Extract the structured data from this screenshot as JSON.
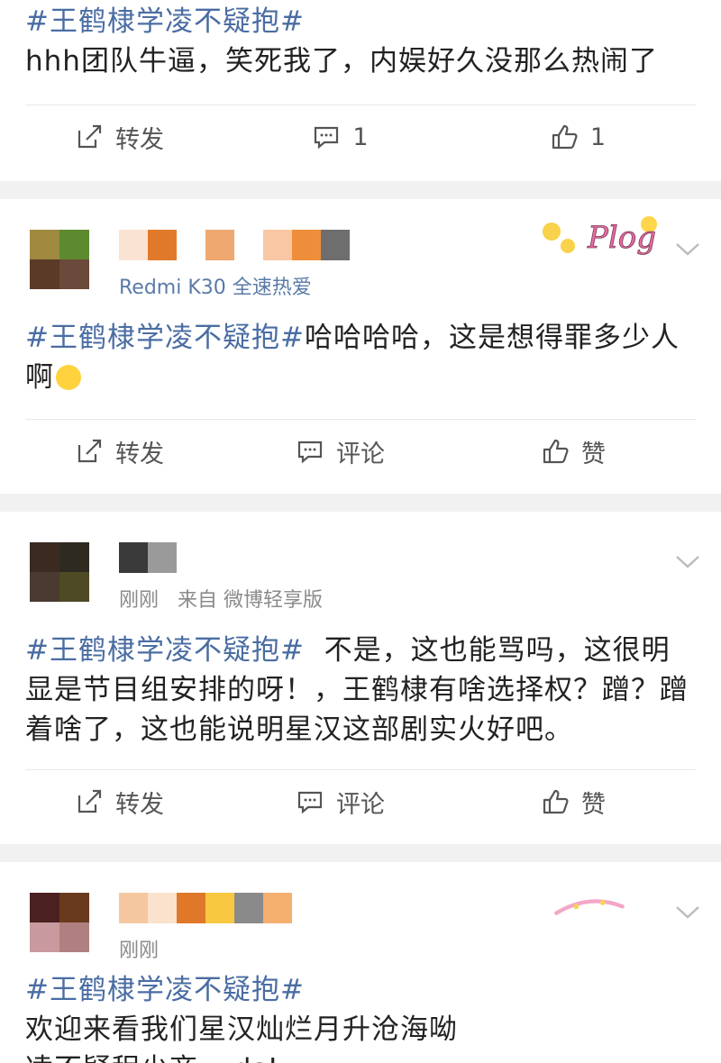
{
  "posts": [
    {
      "text": "hhh团队牛逼，笑死我了，内娱好久没那么热闹了",
      "hashtag": "#王鹤棣学凌不疑抱#",
      "actions": {
        "repost": "转发",
        "comment": "1",
        "like": "1"
      }
    },
    {
      "meta_source": "Redmi K30 全速热爱",
      "deco_label": "Plog",
      "hashtag": "#王鹤棣学凌不疑抱#",
      "text": "哈哈哈哈，这是想得罪多少人啊",
      "actions": {
        "repost": "转发",
        "comment": "评论",
        "like": "赞"
      }
    },
    {
      "meta_time": "刚刚",
      "meta_from": "来自",
      "meta_source": "微博轻享版",
      "hashtag": "#王鹤棣学凌不疑抱#",
      "text": "  不是，这也能骂吗，这很明显是节目组安排的呀！，王鹤棣有啥选择权？蹭？蹭着啥了，这也能说明星汉这部剧实火好吧。",
      "actions": {
        "repost": "转发",
        "comment": "评论",
        "like": "赞"
      }
    },
    {
      "meta_time": "刚刚",
      "hashtag": "#王鹤棣学凌不疑抱#",
      "text_line1": "欢迎来看我们星汉灿烂月升沧海呦",
      "text_line2": "凌不疑程少商yyds!"
    }
  ],
  "icons": {
    "repost": "share-icon",
    "comment": "comment-icon",
    "like": "thumbs-up-icon",
    "chevron": "chevron-down-icon",
    "emoji": "laughing-emoji-icon"
  },
  "colors": {
    "hashtag": "#4a6da3",
    "meta": "#8a8a8a",
    "source": "#5a7aa8"
  }
}
